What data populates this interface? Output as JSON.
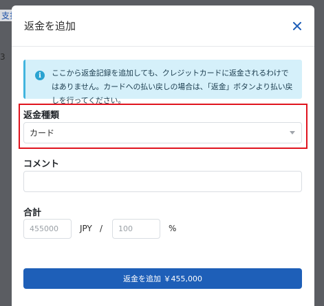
{
  "backdrop": {
    "top_link_fragment": "支払",
    "side_digit_fragment": "3"
  },
  "modal": {
    "title": "返金を追加",
    "close_icon": "close-icon",
    "info": {
      "icon": "info-icon",
      "text": "ここから返金記録を追加しても、クレジットカードに返金されるわけではありません。カードへの払い戻しの場合は、「返金」ボタンより払い戻しを行ってください。"
    },
    "refund_type": {
      "label": "返金種類",
      "selected": "カード"
    },
    "comment": {
      "label": "コメント",
      "value": ""
    },
    "total": {
      "label": "合計",
      "amount_placeholder": "455000",
      "currency": "JPY",
      "separator": "/",
      "percent_placeholder": "100",
      "percent_unit": "%"
    },
    "submit_label": "返金を追加 ￥455,000"
  },
  "colors": {
    "accent": "#1e5fb8",
    "info_bg": "#d5f0fa",
    "highlight": "#e0121d"
  }
}
